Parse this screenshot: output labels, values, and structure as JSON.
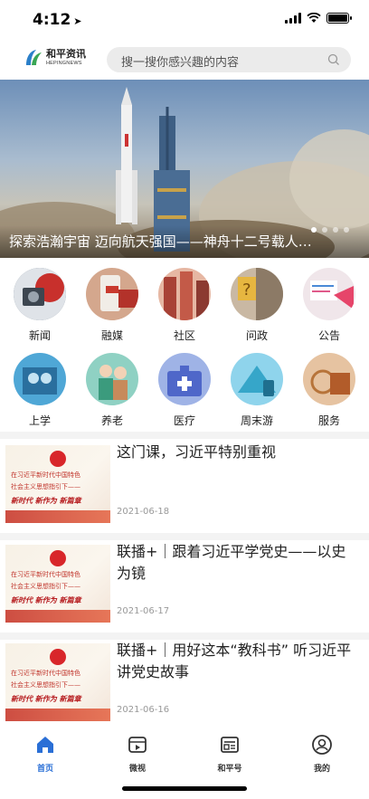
{
  "status_bar": {
    "time": "4:12"
  },
  "header": {
    "logo_cn": "和平资讯",
    "logo_en": "HEPINGNEWS",
    "search_placeholder": "搜一搜你感兴趣的内容"
  },
  "banner": {
    "title": "探索浩瀚宇宙 迈向航天强国——神舟十二号载人…",
    "dots": 4,
    "active_dot": 0
  },
  "categories": [
    {
      "label": "新闻",
      "icon": "news-icon"
    },
    {
      "label": "融媒",
      "icon": "media-icon"
    },
    {
      "label": "社区",
      "icon": "community-icon"
    },
    {
      "label": "问政",
      "icon": "inquiry-icon"
    },
    {
      "label": "公告",
      "icon": "notice-icon"
    },
    {
      "label": "上学",
      "icon": "school-icon"
    },
    {
      "label": "养老",
      "icon": "elderly-icon"
    },
    {
      "label": "医疗",
      "icon": "medical-icon"
    },
    {
      "label": "周末游",
      "icon": "travel-icon"
    },
    {
      "label": "服务",
      "icon": "service-icon"
    }
  ],
  "news": [
    {
      "title": "这门课，习近平特别重视",
      "date": "2021-06-18"
    },
    {
      "title": "联播+｜跟着习近平学党史——以史为镜",
      "date": "2021-06-17"
    },
    {
      "title": "联播+｜用好这本“教科书” 听习近平讲党史故事",
      "date": "2021-06-16"
    }
  ],
  "thumb_text": {
    "line1": "在习近平新时代中国特色",
    "line2": "社会主义思想指引下——",
    "line3": "新时代 新作为 新篇章"
  },
  "tabs": [
    {
      "label": "首页",
      "icon": "home-icon",
      "active": true
    },
    {
      "label": "微视",
      "icon": "video-icon",
      "active": false
    },
    {
      "label": "和平号",
      "icon": "article-icon",
      "active": false
    },
    {
      "label": "我的",
      "icon": "profile-icon",
      "active": false
    }
  ],
  "colors": {
    "accent": "#2a6fd6",
    "brand_green": "#3aa655",
    "text": "#222222",
    "date": "#999999"
  }
}
